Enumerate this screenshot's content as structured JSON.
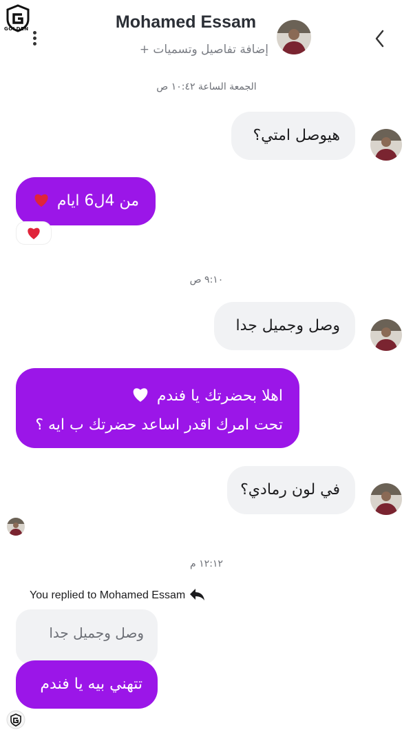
{
  "app": {
    "logo_text": "GOLDEN"
  },
  "header": {
    "title": "Mohamed Essam",
    "subtitle": "+ إضافة تفاصيل وتسميات"
  },
  "messages": {
    "ts1": "الجمعة الساعة ١٠:٤٢ ص",
    "m1": "هيوصل امتي؟",
    "m2": "من 4ل6 ايام",
    "ts2": "٩:١٠ ص",
    "m3": "وصل وجميل جدا",
    "m4_line1": "اهلا بحضرتك يا فندم",
    "m4_line2": "تحت امرك اقدر اساعد حضرتك ب ايه ؟",
    "m5": "في لون رمادي؟",
    "ts3": "١٢:١٢ م",
    "reply_label": "You replied to Mohamed Essam",
    "quoted": "وصل وجميل جدا",
    "m6": "تتهني بيه يا فندم"
  },
  "colors": {
    "accent": "#9b16e8",
    "incoming_bubble": "#f1f2f4",
    "heart_red": "#e0243a"
  },
  "icons": [
    "golden-logo-icon",
    "more-options-icon",
    "back-chevron-icon",
    "heart-icon",
    "white-heart-icon",
    "reply-arrow-icon"
  ]
}
